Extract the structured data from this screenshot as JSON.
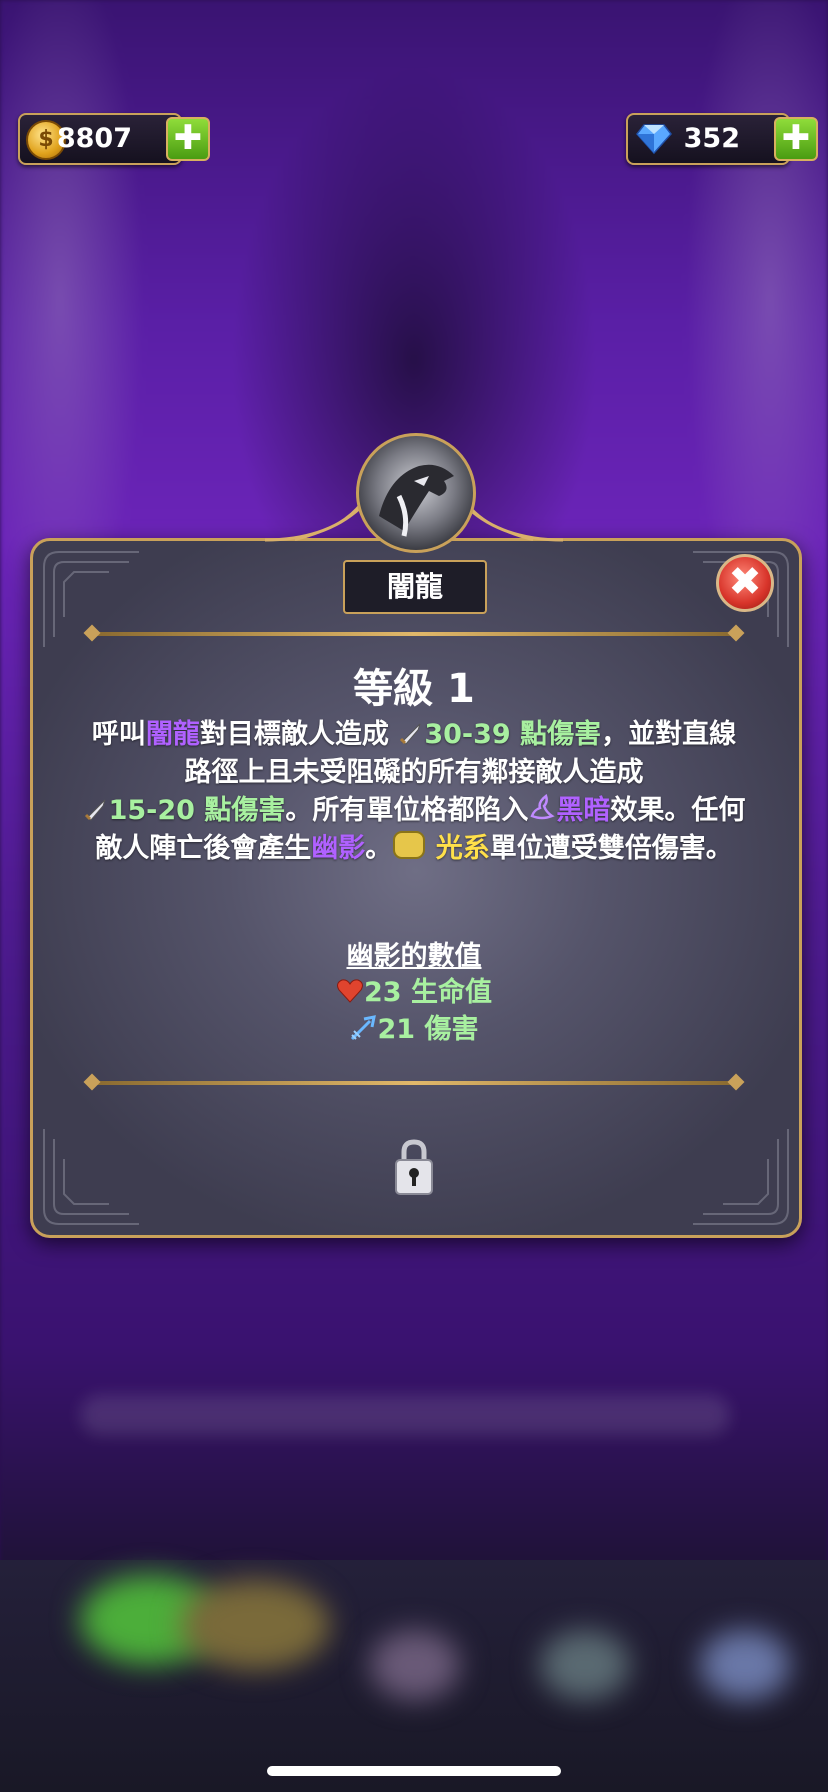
{
  "currency": {
    "gold_amount": "8807",
    "gold_icon_glyph": "𝌆",
    "gem_amount": "352",
    "plus_glyph": "✚"
  },
  "dialog": {
    "title": "闇龍",
    "close_glyph": "✖",
    "level": "等級 1",
    "desc": {
      "p1": "呼叫",
      "unit_name": "闇龍",
      "p2": "對目標敵人造成 ",
      "dmg1": "30-39 點傷害",
      "p3": "，並對直線路徑上且未受阻礙的所有鄰接敵人造成",
      "dmg2": "15-20 點傷害",
      "p4": "。所有單位格都陷入",
      "effect": "黑暗",
      "p5": "效果。任何敵人陣亡後會產生",
      "summon": "幽影",
      "p6": "。",
      "element": "光系",
      "p7": "單位遭受雙倍傷害。"
    },
    "stats_title": "幽影的數值",
    "stat_hp": "23 生命值",
    "stat_damage": "21 傷害"
  },
  "colors": {
    "accent_gold": "#c9a15a",
    "keyword_purple": "#b061ff",
    "value_green": "#a8f0a0",
    "element_yellow": "#ffe04a"
  },
  "icons": [
    "gold-coin-icon",
    "gem-icon",
    "plus-icon",
    "close-icon",
    "sword-icon",
    "darkness-icon",
    "light-element-icon",
    "heart-icon",
    "arrow-icon",
    "lock-icon"
  ]
}
